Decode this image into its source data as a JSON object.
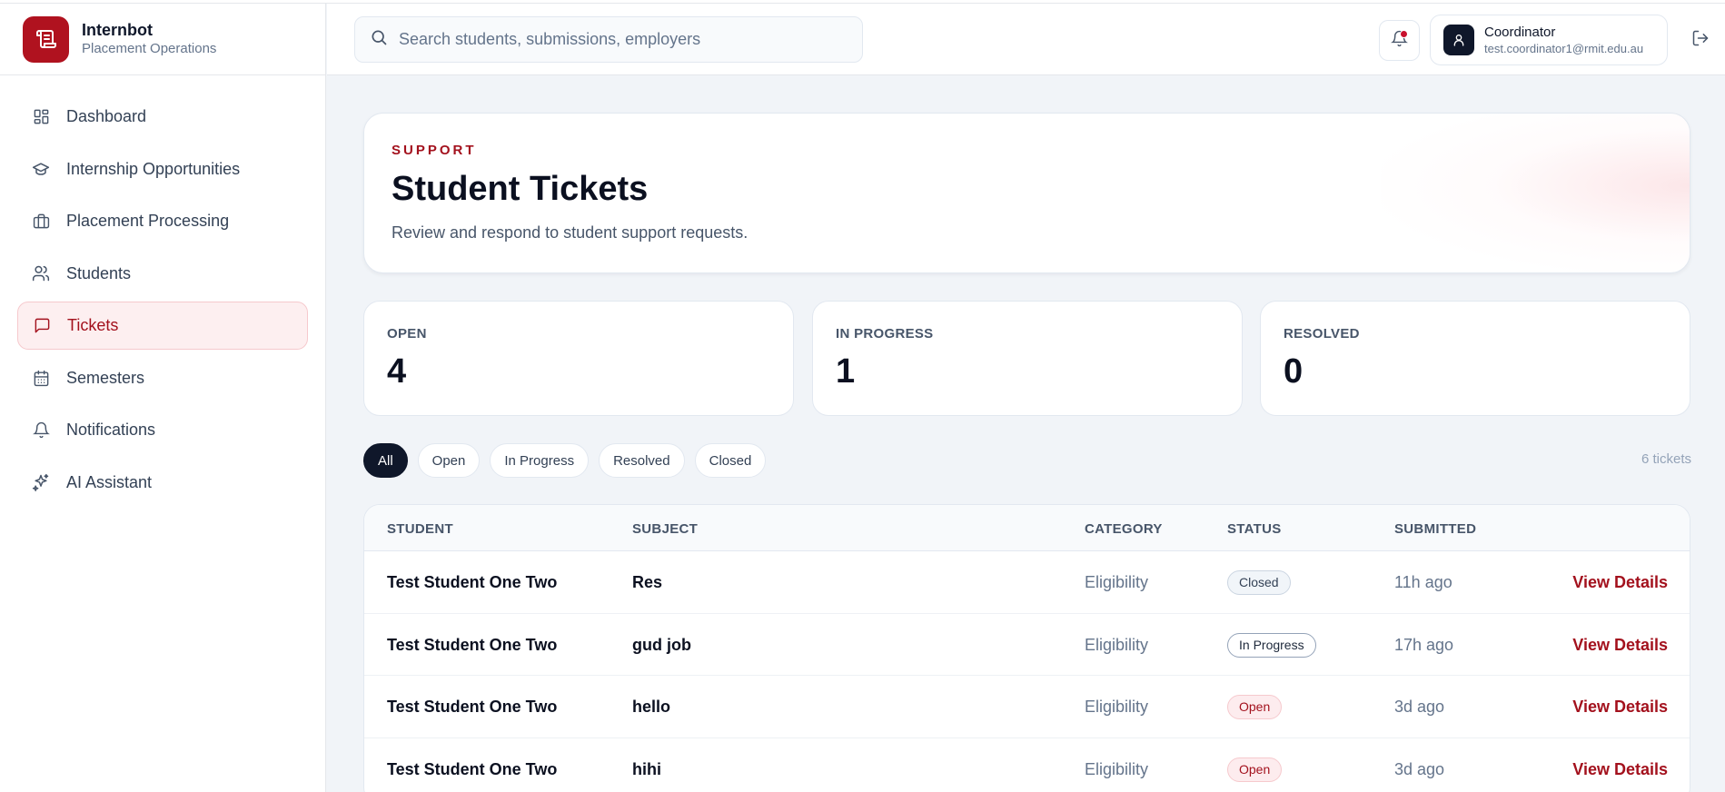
{
  "brand": {
    "name": "Internbot",
    "subtitle": "Placement Operations"
  },
  "nav": [
    {
      "label": "Dashboard",
      "icon": "dashboard-icon"
    },
    {
      "label": "Internship Opportunities",
      "icon": "graduation-cap-icon"
    },
    {
      "label": "Placement Processing",
      "icon": "briefcase-icon"
    },
    {
      "label": "Students",
      "icon": "users-icon"
    },
    {
      "label": "Tickets",
      "icon": "message-square-icon",
      "active": true
    },
    {
      "label": "Semesters",
      "icon": "calendar-icon"
    },
    {
      "label": "Notifications",
      "icon": "bell-icon"
    },
    {
      "label": "AI Assistant",
      "icon": "sparkles-icon"
    }
  ],
  "header": {
    "search_placeholder": "Search students, submissions, employers",
    "user": {
      "role": "Coordinator",
      "email": "test.coordinator1@rmit.edu.au"
    }
  },
  "hero": {
    "eyebrow": "SUPPORT",
    "title": "Student Tickets",
    "subtitle": "Review and respond to student support requests."
  },
  "stats": [
    {
      "label": "OPEN",
      "value": "4"
    },
    {
      "label": "IN PROGRESS",
      "value": "1"
    },
    {
      "label": "RESOLVED",
      "value": "0"
    }
  ],
  "filters": [
    "All",
    "Open",
    "In Progress",
    "Resolved",
    "Closed"
  ],
  "active_filter": "All",
  "ticket_count": "6 tickets",
  "table": {
    "columns": [
      "STUDENT",
      "SUBJECT",
      "CATEGORY",
      "STATUS",
      "SUBMITTED"
    ],
    "rows": [
      {
        "student": "Test Student One Two",
        "subject": "Res",
        "category": "Eligibility",
        "status": "Closed",
        "submitted": "11h ago",
        "action": "View Details"
      },
      {
        "student": "Test Student One Two",
        "subject": "gud job",
        "category": "Eligibility",
        "status": "In Progress",
        "submitted": "17h ago",
        "action": "View Details"
      },
      {
        "student": "Test Student One Two",
        "subject": "hello",
        "category": "Eligibility",
        "status": "Open",
        "submitted": "3d ago",
        "action": "View Details"
      },
      {
        "student": "Test Student One Two",
        "subject": "hihi",
        "category": "Eligibility",
        "status": "Open",
        "submitted": "3d ago",
        "action": "View Details"
      }
    ]
  },
  "colors": {
    "accent": "#a3111d",
    "brand": "#b0121f",
    "dark": "#0f172a"
  }
}
